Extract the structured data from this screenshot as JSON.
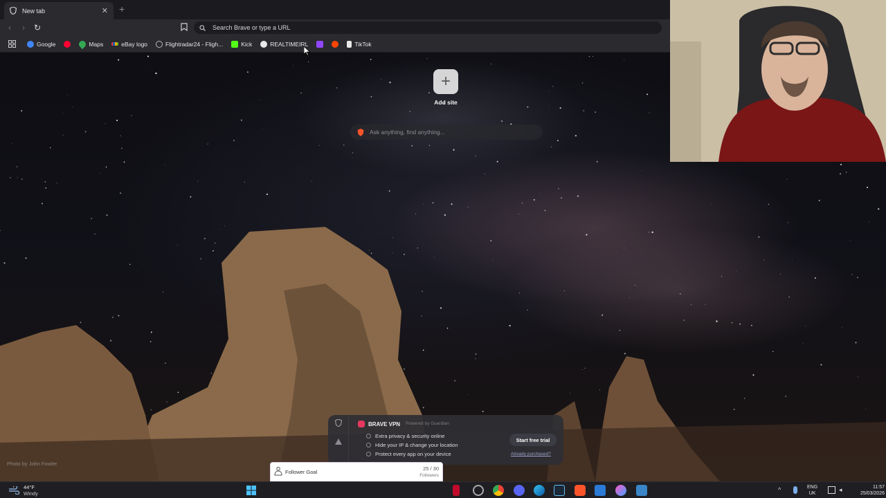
{
  "browser": {
    "tab": {
      "title": "New tab",
      "close_icon": "close-icon"
    },
    "omnibox": {
      "placeholder": "Search Brave or type a URL"
    },
    "bookmarks": [
      {
        "label": "Google",
        "icon": "google-icon",
        "color": "#4285f4"
      },
      {
        "label": "",
        "icon": "youtube-icon",
        "color": "#ff0033"
      },
      {
        "label": "Maps",
        "icon": "maps-icon",
        "color": "#34a853"
      },
      {
        "label": "eBay logo",
        "icon": "ebay-icon",
        "color": "#e53238"
      },
      {
        "label": "Flightradar24 - Fligh...",
        "icon": "globe-icon",
        "color": "#bbbbbb"
      },
      {
        "label": "Kick",
        "icon": "kick-icon",
        "color": "#53fc18"
      },
      {
        "label": "REALTIMEIRL",
        "icon": "realtimeirl-icon",
        "color": "#e8e8e8"
      },
      {
        "label": "",
        "icon": "twitch-icon",
        "color": "#9146ff"
      },
      {
        "label": "",
        "icon": "reddit-icon",
        "color": "#ff4500"
      },
      {
        "label": "TikTok",
        "icon": "tiktok-icon",
        "color": "#e8e8e8"
      }
    ]
  },
  "newtab": {
    "add_site_label": "Add site",
    "ask_placeholder": "Ask anything, find anything...",
    "photo_credit": "Photo by John Fowler"
  },
  "vpn": {
    "title": "BRAVE VPN",
    "powered": "Powered by Guardian",
    "features": [
      "Extra privacy & security online",
      "Hide your IP & change your location",
      "Protect every app on your device"
    ],
    "cta": "Start free trial",
    "link": "Already purchased?"
  },
  "goal": {
    "title": "Follower Goal",
    "count": "25 / 30",
    "unit": "Followers",
    "progress": 0.83
  },
  "taskbar": {
    "weather_temp": "44°F",
    "weather_desc": "Windy",
    "lang_top": "ENG",
    "lang_bottom": "UK",
    "time": "11:57",
    "date": "25/03/2026"
  },
  "colors": {
    "brave_orange": "#fb542b",
    "goal_purple": "#9b64d6"
  }
}
